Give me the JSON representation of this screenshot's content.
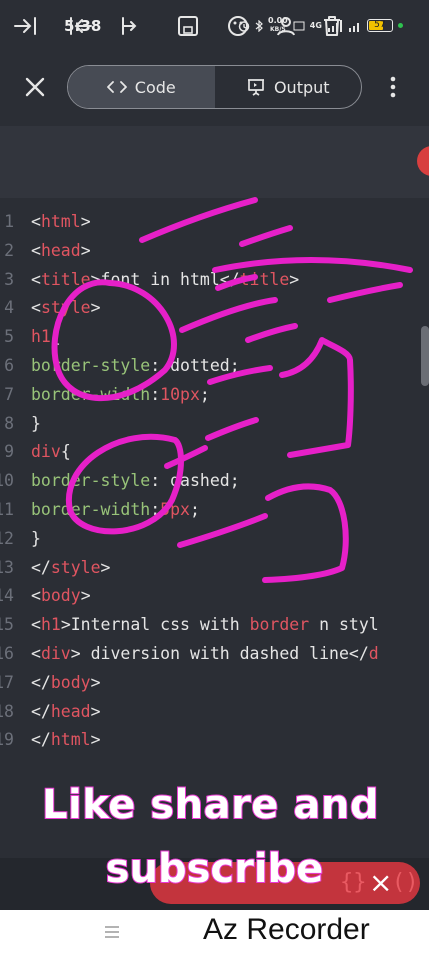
{
  "status_bar": {
    "time": "5:38",
    "net_speed_value": "0.00",
    "net_speed_unit": "KB/S",
    "signal_label": "4G",
    "battery": "57"
  },
  "toolbar": {
    "tabs": [
      {
        "label": "Code",
        "icon": "code-brackets-icon",
        "active": true
      },
      {
        "label": "Output",
        "icon": "presentation-icon",
        "active": false
      }
    ]
  },
  "editor": {
    "lines": [
      {
        "num": "1",
        "parts": [
          {
            "t": "<",
            "c": "plain"
          },
          {
            "t": "html",
            "c": "tag"
          },
          {
            "t": ">",
            "c": "plain"
          }
        ]
      },
      {
        "num": "2",
        "parts": [
          {
            "t": "<",
            "c": "plain"
          },
          {
            "t": "head",
            "c": "tag"
          },
          {
            "t": ">",
            "c": "plain"
          }
        ]
      },
      {
        "num": "3",
        "parts": [
          {
            "t": "<",
            "c": "plain"
          },
          {
            "t": "title",
            "c": "tag"
          },
          {
            "t": ">font in html</",
            "c": "plain"
          },
          {
            "t": "title",
            "c": "tag"
          },
          {
            "t": ">",
            "c": "plain"
          }
        ]
      },
      {
        "num": "4",
        "parts": [
          {
            "t": "<",
            "c": "plain"
          },
          {
            "t": "style",
            "c": "tag"
          },
          {
            "t": ">",
            "c": "plain"
          }
        ]
      },
      {
        "num": "5",
        "parts": [
          {
            "t": "h1",
            "c": "tag"
          },
          {
            "t": "{",
            "c": "plain"
          }
        ]
      },
      {
        "num": "6",
        "parts": [
          {
            "t": "border-style",
            "c": "attr"
          },
          {
            "t": ": dotted;",
            "c": "plain"
          }
        ]
      },
      {
        "num": "7",
        "parts": [
          {
            "t": "border-width",
            "c": "attr"
          },
          {
            "t": ":",
            "c": "plain"
          },
          {
            "t": "10px",
            "c": "tag"
          },
          {
            "t": ";",
            "c": "plain"
          }
        ]
      },
      {
        "num": "8",
        "parts": [
          {
            "t": "}",
            "c": "plain"
          }
        ]
      },
      {
        "num": "9",
        "parts": [
          {
            "t": "div",
            "c": "tag"
          },
          {
            "t": "{",
            "c": "plain"
          }
        ]
      },
      {
        "num": "10",
        "parts": [
          {
            "t": "border-style",
            "c": "attr"
          },
          {
            "t": ": dashed;",
            "c": "plain"
          }
        ]
      },
      {
        "num": "11",
        "parts": [
          {
            "t": "border-width",
            "c": "attr"
          },
          {
            "t": ":",
            "c": "plain"
          },
          {
            "t": "5px",
            "c": "tag"
          },
          {
            "t": ";",
            "c": "plain"
          }
        ]
      },
      {
        "num": "12",
        "parts": [
          {
            "t": "}",
            "c": "plain"
          }
        ]
      },
      {
        "num": "13",
        "parts": [
          {
            "t": "</",
            "c": "plain"
          },
          {
            "t": "style",
            "c": "tag"
          },
          {
            "t": ">",
            "c": "plain"
          }
        ]
      },
      {
        "num": "14",
        "parts": [
          {
            "t": "<",
            "c": "plain"
          },
          {
            "t": "body",
            "c": "tag"
          },
          {
            "t": ">",
            "c": "plain"
          }
        ]
      },
      {
        "num": "15",
        "parts": [
          {
            "t": "<",
            "c": "plain"
          },
          {
            "t": "h1",
            "c": "tag"
          },
          {
            "t": ">Internal css with ",
            "c": "plain"
          },
          {
            "t": "border",
            "c": "tag"
          },
          {
            "t": " n styl",
            "c": "plain"
          }
        ]
      },
      {
        "num": "16",
        "parts": [
          {
            "t": "<",
            "c": "plain"
          },
          {
            "t": "div",
            "c": "tag"
          },
          {
            "t": "> diversion with dashed line</",
            "c": "plain"
          },
          {
            "t": "d",
            "c": "tag"
          }
        ]
      },
      {
        "num": "17",
        "parts": [
          {
            "t": "</",
            "c": "plain"
          },
          {
            "t": "body",
            "c": "tag"
          },
          {
            "t": ">",
            "c": "plain"
          }
        ]
      },
      {
        "num": "18",
        "parts": [
          {
            "t": "</",
            "c": "plain"
          },
          {
            "t": "head",
            "c": "tag"
          },
          {
            "t": ">",
            "c": "plain"
          }
        ]
      },
      {
        "num": "19",
        "parts": [
          {
            "t": "</",
            "c": "plain"
          },
          {
            "t": "html",
            "c": "tag"
          },
          {
            "t": ">",
            "c": "plain"
          }
        ]
      }
    ]
  },
  "bottom_toolbar": {
    "icons": [
      "tab-right-icon",
      "tab-left-icon",
      "cursor-icon",
      "save-icon",
      "palette-icon",
      "person-icon",
      "delete-icon",
      "braces-icon",
      "close-icon",
      "parentheses-icon"
    ],
    "braces_text": "{}",
    "close_text": "×",
    "parens_text": "()"
  },
  "overlay": {
    "caption_line1": "Like share and",
    "caption_line2": "subscribe",
    "watermark": "Az Recorder"
  },
  "colors": {
    "background": "#2b2e35",
    "tag": "#e05561",
    "attribute": "#98c379",
    "annotation": "#e620c8",
    "action_pill": "#c3343d"
  }
}
